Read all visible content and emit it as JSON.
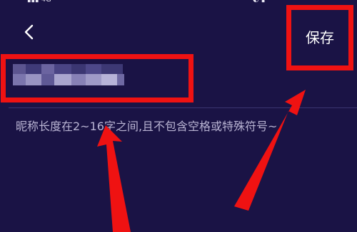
{
  "header": {
    "save_label": "保存",
    "back_icon": "chevron-left-icon"
  },
  "nickname": {
    "value": ""
  },
  "hint": {
    "text": "昵称长度在2~16字之间,且不包含空格或特殊符号~"
  },
  "colors": {
    "background": "#1a1345",
    "highlight": "#ef1212",
    "hint_text": "#b9b4d3",
    "title_text": "#ffffff"
  }
}
